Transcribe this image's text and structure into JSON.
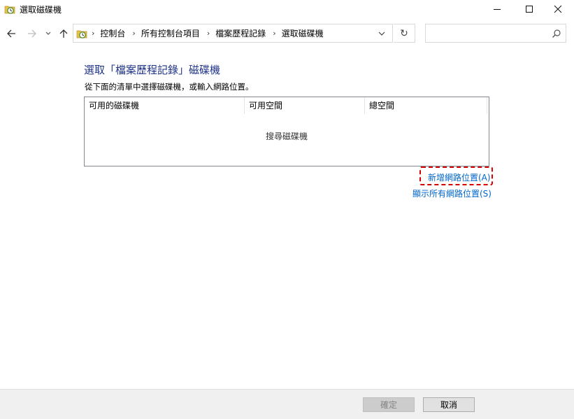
{
  "window": {
    "title": "選取磁碟機",
    "icon": "file-history-icon",
    "controls": [
      "minimize-icon",
      "maximize-icon",
      "close-icon"
    ]
  },
  "nav": {
    "back_icon": "arrow-left-icon",
    "forward_icon": "arrow-right-icon",
    "recent_icon": "chevron-down-icon",
    "up_icon": "arrow-up-icon"
  },
  "address": {
    "breadcrumbs": [
      "控制台",
      "所有控制台項目",
      "檔案歷程記錄",
      "選取磁碟機"
    ],
    "separator": "›",
    "refresh_glyph": "↻"
  },
  "search": {
    "value": "",
    "placeholder": ""
  },
  "main": {
    "heading": "選取「檔案歷程記錄」磁碟機",
    "subtext": "從下面的清單中選擇磁碟機，或輸入網路位置。",
    "list": {
      "columns": [
        "可用的磁碟機",
        "可用空間",
        "總空間"
      ],
      "status": "搜尋磁碟機"
    },
    "links": {
      "add_network": "新增網路位置(A)",
      "show_all": "顯示所有網路位置(S)"
    }
  },
  "footer": {
    "ok_label": "確定",
    "cancel_label": "取消"
  },
  "colors": {
    "heading": "#1e3287",
    "link": "#0066cc",
    "highlight": "#d60000"
  }
}
